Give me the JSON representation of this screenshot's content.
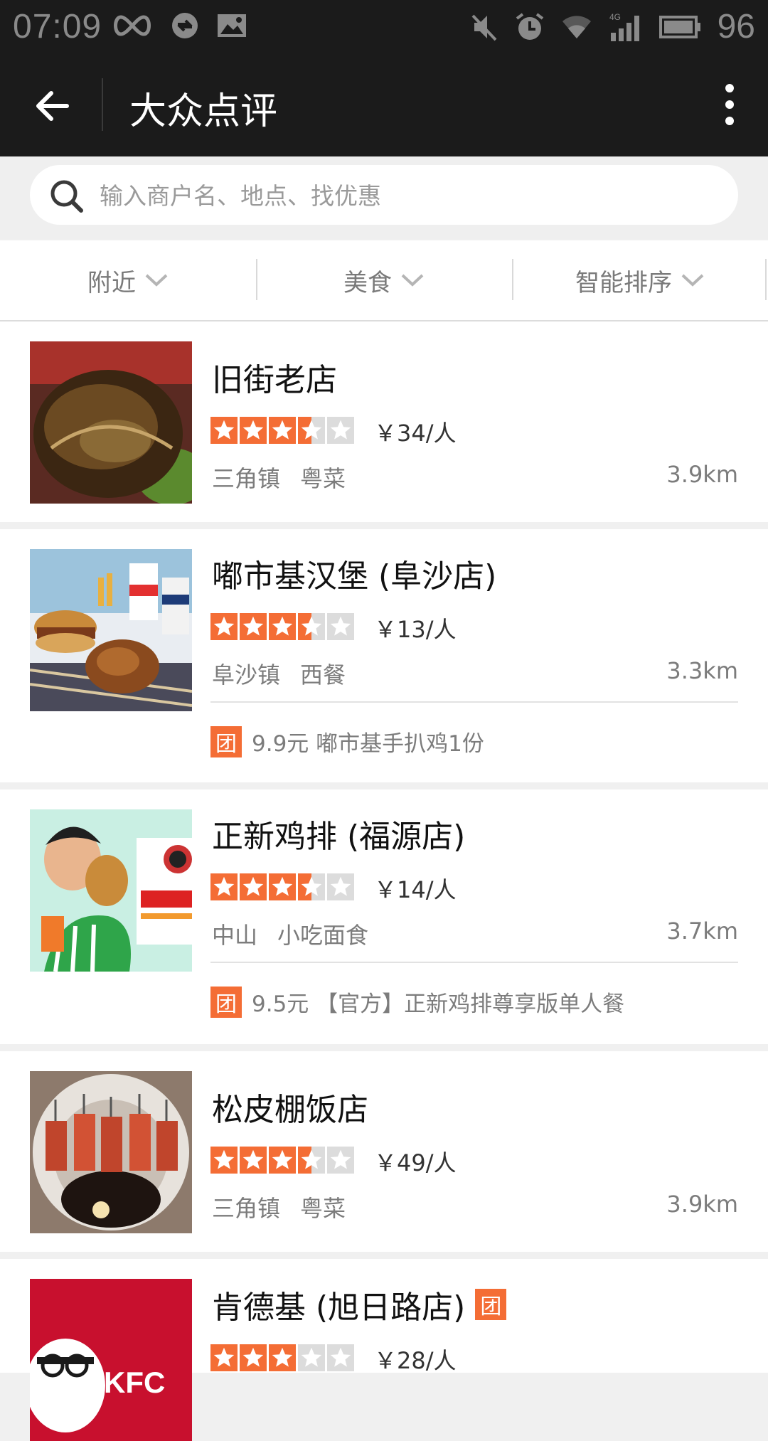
{
  "status_bar": {
    "time": "07:09",
    "battery": "96",
    "left_icons": [
      "infinity-icon",
      "sync-icon",
      "image-icon"
    ],
    "right_icons": [
      "mute-icon",
      "alarm-icon",
      "wifi-icon",
      "signal-4g-icon",
      "battery-icon"
    ]
  },
  "app_bar": {
    "title": "大众点评"
  },
  "search": {
    "placeholder": "输入商户名、地点、找优惠"
  },
  "filters": [
    {
      "label": "附近"
    },
    {
      "label": "美食"
    },
    {
      "label": "智能排序"
    }
  ],
  "colors": {
    "star_on": "#f46d35",
    "star_off": "#dcdcdc",
    "badge": "#f46d35",
    "header_bg": "#1b1b1b"
  },
  "listings": [
    {
      "name": "旧街老店",
      "rating": 3.5,
      "price": "￥34/人",
      "area": "三角镇",
      "category": "粤菜",
      "distance": "3.9km"
    },
    {
      "name": "嘟市基汉堡 (阜沙店)",
      "rating": 3.5,
      "price": "￥13/人",
      "area": "阜沙镇",
      "category": "西餐",
      "distance": "3.3km",
      "deal_badge": "团",
      "deal": "9.9元 嘟市基手扒鸡1份"
    },
    {
      "name": "正新鸡排 (福源店)",
      "rating": 3.5,
      "price": "￥14/人",
      "area": "中山",
      "category": "小吃面食",
      "distance": "3.7km",
      "deal_badge": "团",
      "deal": "9.5元 【官方】正新鸡排尊享版单人餐"
    },
    {
      "name": "松皮棚饭店",
      "rating": 3.5,
      "price": "￥49/人",
      "area": "三角镇",
      "category": "粤菜",
      "distance": "3.9km"
    },
    {
      "name": "肯德基 (旭日路店)",
      "name_badge": "团",
      "rating": 3,
      "price": "￥28/人",
      "thumb_text": "KFC"
    }
  ]
}
